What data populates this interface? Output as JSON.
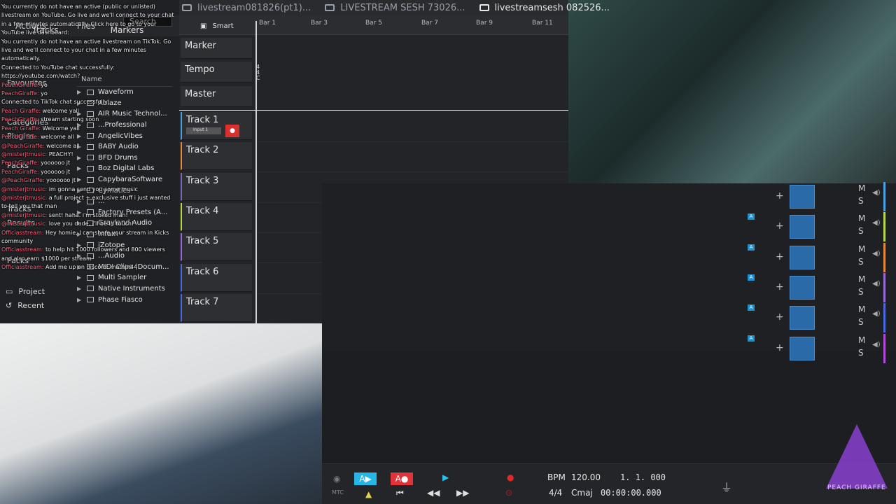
{
  "tabs": [
    {
      "label": "livestream081826(pt1)..."
    },
    {
      "label": "LIVESTREAM SESH 73026..."
    },
    {
      "label": "livestreamsesh 082526..."
    }
  ],
  "browser": {
    "tabs": [
      "Actions",
      "Files",
      "Tracks",
      "Markers"
    ],
    "search_placeholder": "Search",
    "tree_header": "Name",
    "items": [
      "Waveform",
      "Ablaze",
      "AIR Music Technol...",
      "...Professional",
      "AngelicVibes",
      "BABY Audio",
      "BFD Drums",
      "Boz Digital Labs",
      "CapybaraSoftware",
      "Cymatics",
      "...",
      "Factory Presets (A...",
      "Grayland Audio",
      "Infam",
      "iZotope",
      "...Audio",
      "MIDI Clips (Docum...",
      "Multi Sampler",
      "Native Instruments",
      "Phase Fiasco"
    ],
    "categories": [
      "Favourites",
      "Categories",
      "Plugins",
      "Packs",
      "Tracks",
      "Results",
      "Packs"
    ],
    "nav": [
      "Project",
      "Recent"
    ]
  },
  "chat": [
    {
      "user": "",
      "text": "You currently do not have an active (public or unlisted) livestream on YouTube. Go live and we'll connect to your chat in a few minutes automatically. Click here to go to your YouTube live dashboard:"
    },
    {
      "user": "",
      "text": "You currently do not have an active livestream on TikTok. Go live and we'll connect to your chat in a few minutes automatically."
    },
    {
      "user": "",
      "text": "Connected to YouTube chat successfully: https://youtube.com/watch?"
    },
    {
      "user": "PeachGiraffe:",
      "text": "yo"
    },
    {
      "user": "PeachGiraffe:",
      "text": "yo"
    },
    {
      "user": "",
      "text": "Connected to TikTok chat successfully"
    },
    {
      "user": "Peach Giraffe:",
      "text": "welcome yall"
    },
    {
      "user": "PeachGiraffe:",
      "text": "stream starting soon"
    },
    {
      "user": "Peach Giraffe:",
      "text": "Welcome yall"
    },
    {
      "user": "PeachGiraffe:",
      "text": "welcome all"
    },
    {
      "user": "@PeachGiraffe:",
      "text": "welcome all"
    },
    {
      "user": "@misterjtmusic:",
      "text": "PEACHY!"
    },
    {
      "user": "PeachGiraffe:",
      "text": "yoooooo jt"
    },
    {
      "user": "PeachGiraffe:",
      "text": "yoooooo jt"
    },
    {
      "user": "@PeachGiraffe:",
      "text": "yoooooo jt"
    },
    {
      "user": "@misterjtmusic:",
      "text": "im gonna send you some music"
    },
    {
      "user": "@misterjtmusic:",
      "text": "a full project + exclusive stuff i just wanted to tell you that man"
    },
    {
      "user": "@misterjtmusic:",
      "text": "sent! haha. i'm stoked man!"
    },
    {
      "user": "@misterjtmusic:",
      "text": "love you dude, i'll be in touch!"
    },
    {
      "user": "Officiasstream:",
      "text": "Hey homie, I can share your stream in Kicks community"
    },
    {
      "user": "Officiasstream:",
      "text": "to help hit 1000 followers and 800 viewers and also earn $1000 per stream"
    },
    {
      "user": "Officiasstream:",
      "text": "Add me up on discord: mathin44"
    }
  ],
  "timeline": {
    "smart_label": "Smart",
    "bars": [
      "Bar 1",
      "Bar 3",
      "Bar 5",
      "Bar 7",
      "Bar 9",
      "Bar 11"
    ],
    "special_tracks": [
      "Marker",
      "Tempo",
      "Master"
    ],
    "tempo_marks": [
      "4",
      "4",
      "C"
    ],
    "tracks": [
      "Track 1",
      "Track 2",
      "Track 3",
      "Track 4",
      "Track 5",
      "Track 6",
      "Track 7"
    ],
    "track1_input": "Input 1"
  },
  "mixer": {
    "mute_label": "M",
    "solo_label": "S",
    "auto_label": "A",
    "strip_colors": [
      "#4aa3df",
      "#b7d84a",
      "#e08a3a",
      "#9a6ad8",
      "#4a6ae0",
      "#b44ad8"
    ]
  },
  "transport": {
    "mtc_label": "MTC",
    "bpm_label": "BPM",
    "bpm_value": "120.00",
    "position": "1. 1. 000",
    "time_sig": "4/4",
    "key": "Cmaj",
    "timecode": "00:00:00.000"
  },
  "logo": {
    "text": "PEACH GIRAFFE"
  }
}
